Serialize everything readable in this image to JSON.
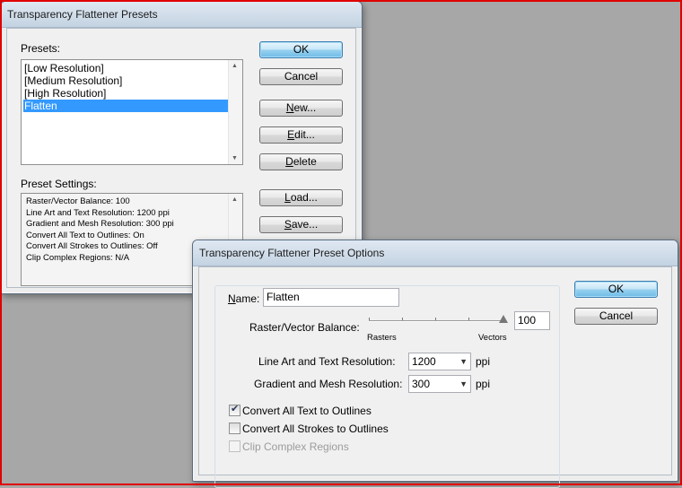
{
  "presets_dialog": {
    "title": "Transparency Flattener Presets",
    "presets_label": "Presets:",
    "presets": [
      "[Low Resolution]",
      "[Medium Resolution]",
      "[High Resolution]",
      "Flatten"
    ],
    "selected_index": 3,
    "preset_settings_label": "Preset Settings:",
    "settings_lines": [
      "Raster/Vector Balance: 100",
      "Line Art and Text Resolution: 1200 ppi",
      "Gradient and Mesh Resolution: 300 ppi",
      "Convert All Text to Outlines: On",
      "Convert All Strokes to Outlines: Off",
      "Clip Complex Regions: N/A"
    ],
    "buttons": {
      "ok": "OK",
      "cancel": "Cancel",
      "new": "New...",
      "edit": "Edit...",
      "delete": "Delete",
      "load": "Load...",
      "save": "Save..."
    }
  },
  "options_dialog": {
    "title": "Transparency Flattener Preset Options",
    "name_label": "Name:",
    "name_value": "Flatten",
    "balance_label": "Raster/Vector Balance:",
    "balance_value": "100",
    "slider_min_label": "Rasters",
    "slider_max_label": "Vectors",
    "slider_level": 1.0,
    "line_art_label": "Line Art and Text Resolution:",
    "line_art_value": "1200",
    "gradient_label": "Gradient and Mesh Resolution:",
    "gradient_value": "300",
    "ppi_unit": "ppi",
    "convert_text_label": "Convert All Text to Outlines",
    "convert_text_checked": true,
    "convert_strokes_label": "Convert All Strokes to Outlines",
    "convert_strokes_checked": false,
    "clip_label": "Clip Complex Regions",
    "clip_enabled": false,
    "buttons": {
      "ok": "OK",
      "cancel": "Cancel"
    }
  }
}
